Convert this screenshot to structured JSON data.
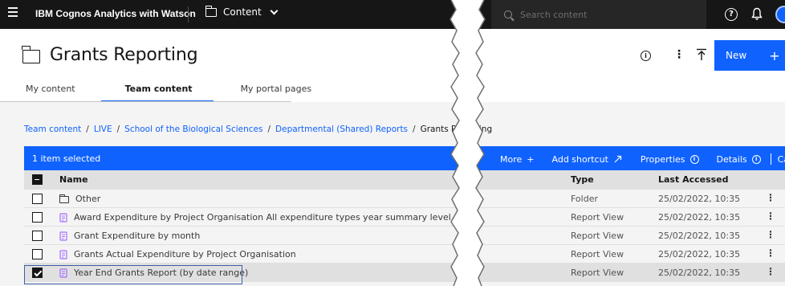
{
  "topbar": {
    "brand": "IBM Cognos Analytics with Watson",
    "content_menu_label": "Content",
    "search_placeholder": "Search content"
  },
  "page": {
    "title": "Grants Reporting",
    "new_button_label": "New",
    "new_button_plus": "+"
  },
  "tabs": [
    {
      "label": "My content",
      "active": false
    },
    {
      "label": "Team content",
      "active": true
    },
    {
      "label": "My portal pages",
      "active": false
    }
  ],
  "breadcrumb": {
    "items": [
      "Team content",
      "LIVE",
      "School of the Biological Sciences",
      "Departmental (Shared) Reports"
    ],
    "current": "Grants Reporting",
    "separator": "/"
  },
  "selection_bar": {
    "count_label": "1 item selected",
    "more_label": "More",
    "more_plus": "+",
    "add_shortcut_label": "Add shortcut",
    "properties_label": "Properties",
    "details_label": "Details",
    "cancel_label": "Cancel"
  },
  "table": {
    "headers": {
      "name": "Name",
      "type": "Type",
      "last_accessed": "Last Accessed"
    },
    "rows": [
      {
        "name": "Other",
        "type": "Folder",
        "last_accessed": "25/02/2022, 10:35",
        "icon": "folder-icon",
        "checked": false
      },
      {
        "name": "Award Expenditure by Project Organisation All expenditure types year summary level",
        "type": "Report View",
        "last_accessed": "25/02/2022, 10:35",
        "icon": "report-view-icon",
        "checked": false
      },
      {
        "name": "Grant Expenditure by month",
        "type": "Report View",
        "last_accessed": "25/02/2022, 10:35",
        "icon": "report-view-icon",
        "checked": false
      },
      {
        "name": "Grants Actual Expenditure by Project Organisation",
        "type": "Report View",
        "last_accessed": "25/02/2022, 10:35",
        "icon": "report-view-icon",
        "checked": false
      },
      {
        "name": "Year End Grants Report (by date range)",
        "type": "Report View",
        "last_accessed": "25/02/2022, 10:35",
        "icon": "report-view-icon",
        "checked": true
      }
    ]
  },
  "colors": {
    "accent": "#0f62fe",
    "topbar": "#161616",
    "report_icon": "#a56eff"
  }
}
